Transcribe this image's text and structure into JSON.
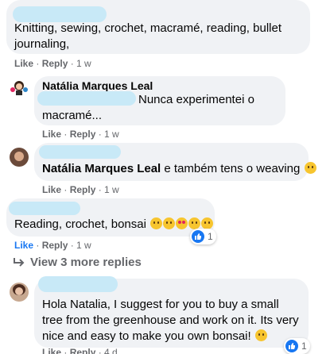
{
  "comment1": {
    "text": "Knitting, sewing, crochet, macramé, reading, bullet journaling,",
    "like": "Like",
    "reply": "Reply",
    "time": "1 w"
  },
  "reply1": {
    "author": "Natália Marques Leal",
    "text": "Nunca experimentei o macramé...",
    "like": "Like",
    "reply": "Reply",
    "time": "1 w"
  },
  "reply2": {
    "author_mention": "Natália Marques Leal",
    "text": " e também tens o weaving ",
    "like": "Like",
    "reply": "Reply",
    "time": "1 w"
  },
  "reply3": {
    "text": "Reading, crochet, bonsai ",
    "like": "Like",
    "reply": "Reply",
    "time": "1 w",
    "reaction_count": "1"
  },
  "view_more": "View 3 more replies",
  "comment2": {
    "text": "Hola Natalia, I suggest for you to buy a small tree from the greenhouse and work on it. Its very nice and easy to make you own bonsai! ",
    "like": "Like",
    "reply": "Reply",
    "time": "4 d",
    "reaction_count": "1"
  },
  "colors": {
    "bubble": "#f0f2f5",
    "redaction": "#c8e9f7",
    "like_blue": "#1877f2",
    "meta": "#65676b"
  }
}
